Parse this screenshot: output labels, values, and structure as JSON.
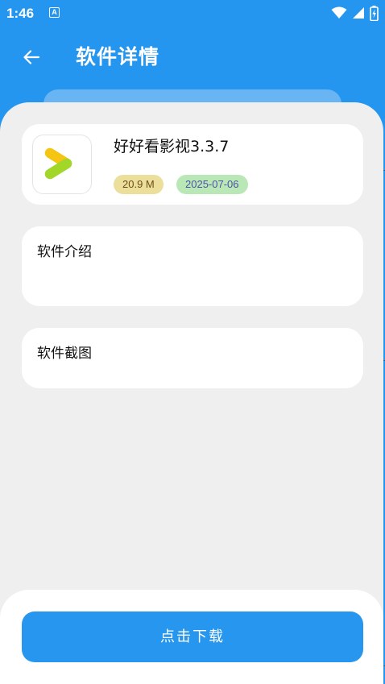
{
  "status_bar": {
    "time": "1:46",
    "app_indicator": "A",
    "icons": [
      "wifi-icon",
      "signal-icon",
      "battery-charging-icon"
    ]
  },
  "app_bar": {
    "title": "软件详情",
    "back_icon": "arrow-left-icon"
  },
  "app_info": {
    "icon": "play-logo-icon",
    "name": "好好看影视3.3.7",
    "size": "20.9 M",
    "date": "2025-07-06"
  },
  "sections": {
    "intro_title": "软件介绍",
    "screenshots_title": "软件截图"
  },
  "download": {
    "label": "点击下载"
  },
  "colors": {
    "primary": "#2596ef",
    "background": "#efefef",
    "size_tag": "#ebdf9b",
    "date_tag": "#b9e8b6"
  }
}
